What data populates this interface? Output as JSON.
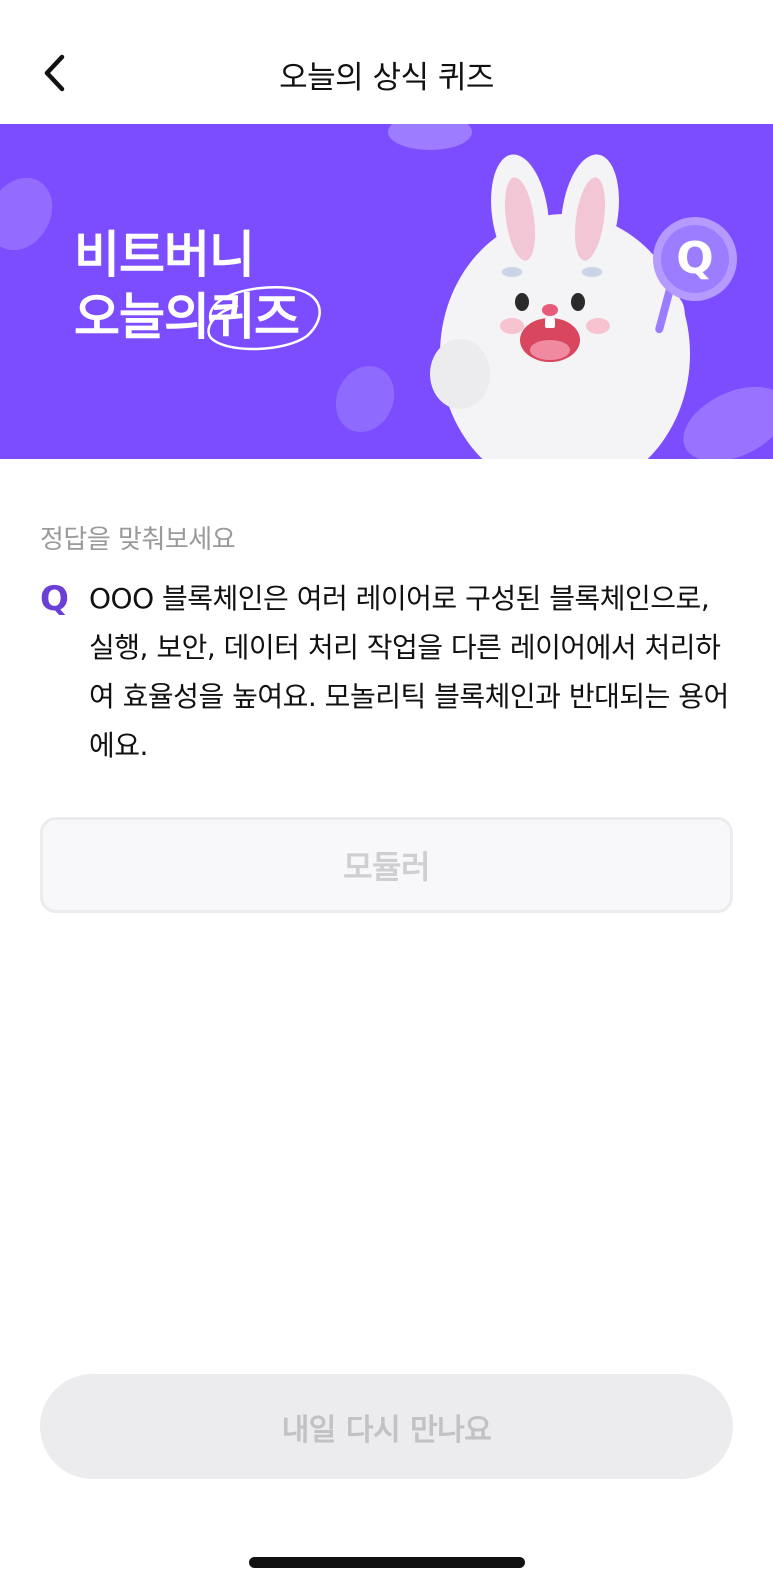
{
  "header": {
    "title": "오늘의 상식 퀴즈",
    "back_icon": "chevron-left-icon"
  },
  "banner": {
    "line1": "비트버니",
    "line2_prefix": "오늘의",
    "line2_circled": "퀴즈",
    "badge_letter": "Q",
    "background_color": "#7c4dff"
  },
  "quiz": {
    "instruction": "정답을 맞춰보세요",
    "q_label": "Q",
    "question": "OOO 블록체인은 여러 레이어로 구성된 블록체인으로, 실행, 보안, 데이터 처리 작업을 다른 레이어에서 처리하여 효율성을 높여요. 모놀리틱 블록체인과 반대되는 용어에요.",
    "answer": "모듈러"
  },
  "footer": {
    "button_label": "내일 다시 만나요"
  },
  "colors": {
    "accent": "#6a3fd6",
    "disabled_text": "#c2c2c6"
  }
}
